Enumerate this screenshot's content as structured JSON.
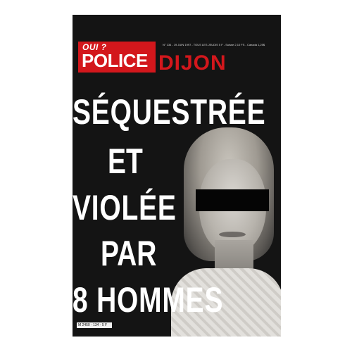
{
  "masthead": {
    "logo_top": "OUI ?",
    "logo_main": "POLICE",
    "city": "DIJON",
    "issue_meta": "N° 134 - 19 JUIN 1997 - TOUS LES JEUDIS 5 F - Suisse 2,10 FS - Canada 1,25$"
  },
  "headline": {
    "line1": "SÉQUESTRÉE",
    "line2": "ET",
    "line3": "VIOLÉE",
    "line4": "PAR",
    "line5": "8 HOMMES"
  },
  "footer": {
    "barcode_text": "M 2450 - 134 - 5 F"
  },
  "colors": {
    "brand_red": "#d3171c",
    "poster_bg": "#141414",
    "headline": "#ffffff"
  }
}
